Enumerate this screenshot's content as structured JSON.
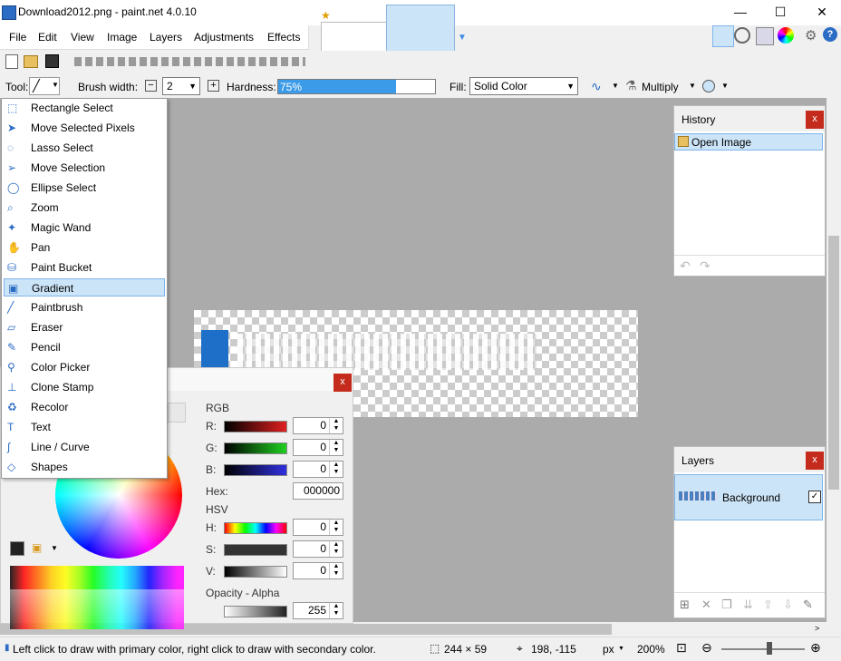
{
  "window": {
    "title": "Download2012.png - paint.net 4.0.10",
    "minimize": "—",
    "maximize": "☐",
    "close": "✕"
  },
  "menu": {
    "items": [
      "File",
      "Edit",
      "View",
      "Image",
      "Layers",
      "Adjustments",
      "Effects"
    ]
  },
  "toolbar": {
    "tool_label": "Tool:",
    "brush_width_label": "Brush width:",
    "brush_width_value": "2",
    "hardness_label": "Hardness:",
    "hardness_value": "75%",
    "hardness_fraction": 0.75,
    "fill_label": "Fill:",
    "fill_value": "Solid Color",
    "blend_value": "Multiply"
  },
  "tools": [
    {
      "label": "Rectangle Select",
      "icon": "rectangle-select-icon"
    },
    {
      "label": "Move Selected Pixels",
      "icon": "move-pixels-icon"
    },
    {
      "label": "Lasso Select",
      "icon": "lasso-icon"
    },
    {
      "label": "Move Selection",
      "icon": "move-selection-icon"
    },
    {
      "label": "Ellipse Select",
      "icon": "ellipse-select-icon"
    },
    {
      "label": "Zoom",
      "icon": "zoom-icon"
    },
    {
      "label": "Magic Wand",
      "icon": "magic-wand-icon"
    },
    {
      "label": "Pan",
      "icon": "pan-icon"
    },
    {
      "label": "Paint Bucket",
      "icon": "paint-bucket-icon"
    },
    {
      "label": "Gradient",
      "icon": "gradient-icon"
    },
    {
      "label": "Paintbrush",
      "icon": "paintbrush-icon"
    },
    {
      "label": "Eraser",
      "icon": "eraser-icon"
    },
    {
      "label": "Pencil",
      "icon": "pencil-icon"
    },
    {
      "label": "Color Picker",
      "icon": "color-picker-icon"
    },
    {
      "label": "Clone Stamp",
      "icon": "clone-stamp-icon"
    },
    {
      "label": "Recolor",
      "icon": "recolor-icon"
    },
    {
      "label": "Text",
      "icon": "text-icon"
    },
    {
      "label": "Line / Curve",
      "icon": "line-curve-icon"
    },
    {
      "label": "Shapes",
      "icon": "shapes-icon"
    }
  ],
  "selected_tool": "Gradient",
  "colors": {
    "rgb_label": "RGB",
    "r_label": "R:",
    "r_value": "0",
    "g_label": "G:",
    "g_value": "0",
    "b_label": "B:",
    "b_value": "0",
    "hex_label": "Hex:",
    "hex_value": "000000",
    "hsv_label": "HSV",
    "h_label": "H:",
    "h_value": "0",
    "s_label": "S:",
    "s_value": "0",
    "v_label": "V:",
    "v_value": "0",
    "opacity_label": "Opacity - Alpha",
    "alpha_value": "255"
  },
  "history": {
    "title": "History",
    "items": [
      "Open Image"
    ]
  },
  "layers": {
    "title": "Layers",
    "items": [
      {
        "name": "Background",
        "visible": true
      }
    ]
  },
  "status": {
    "hint": "Left click to draw with primary color, right click to draw with secondary color.",
    "image_size": "244 × 59",
    "cursor_pos": "198, -115",
    "units": "px",
    "zoom": "200%"
  },
  "accent": "#0078d7"
}
